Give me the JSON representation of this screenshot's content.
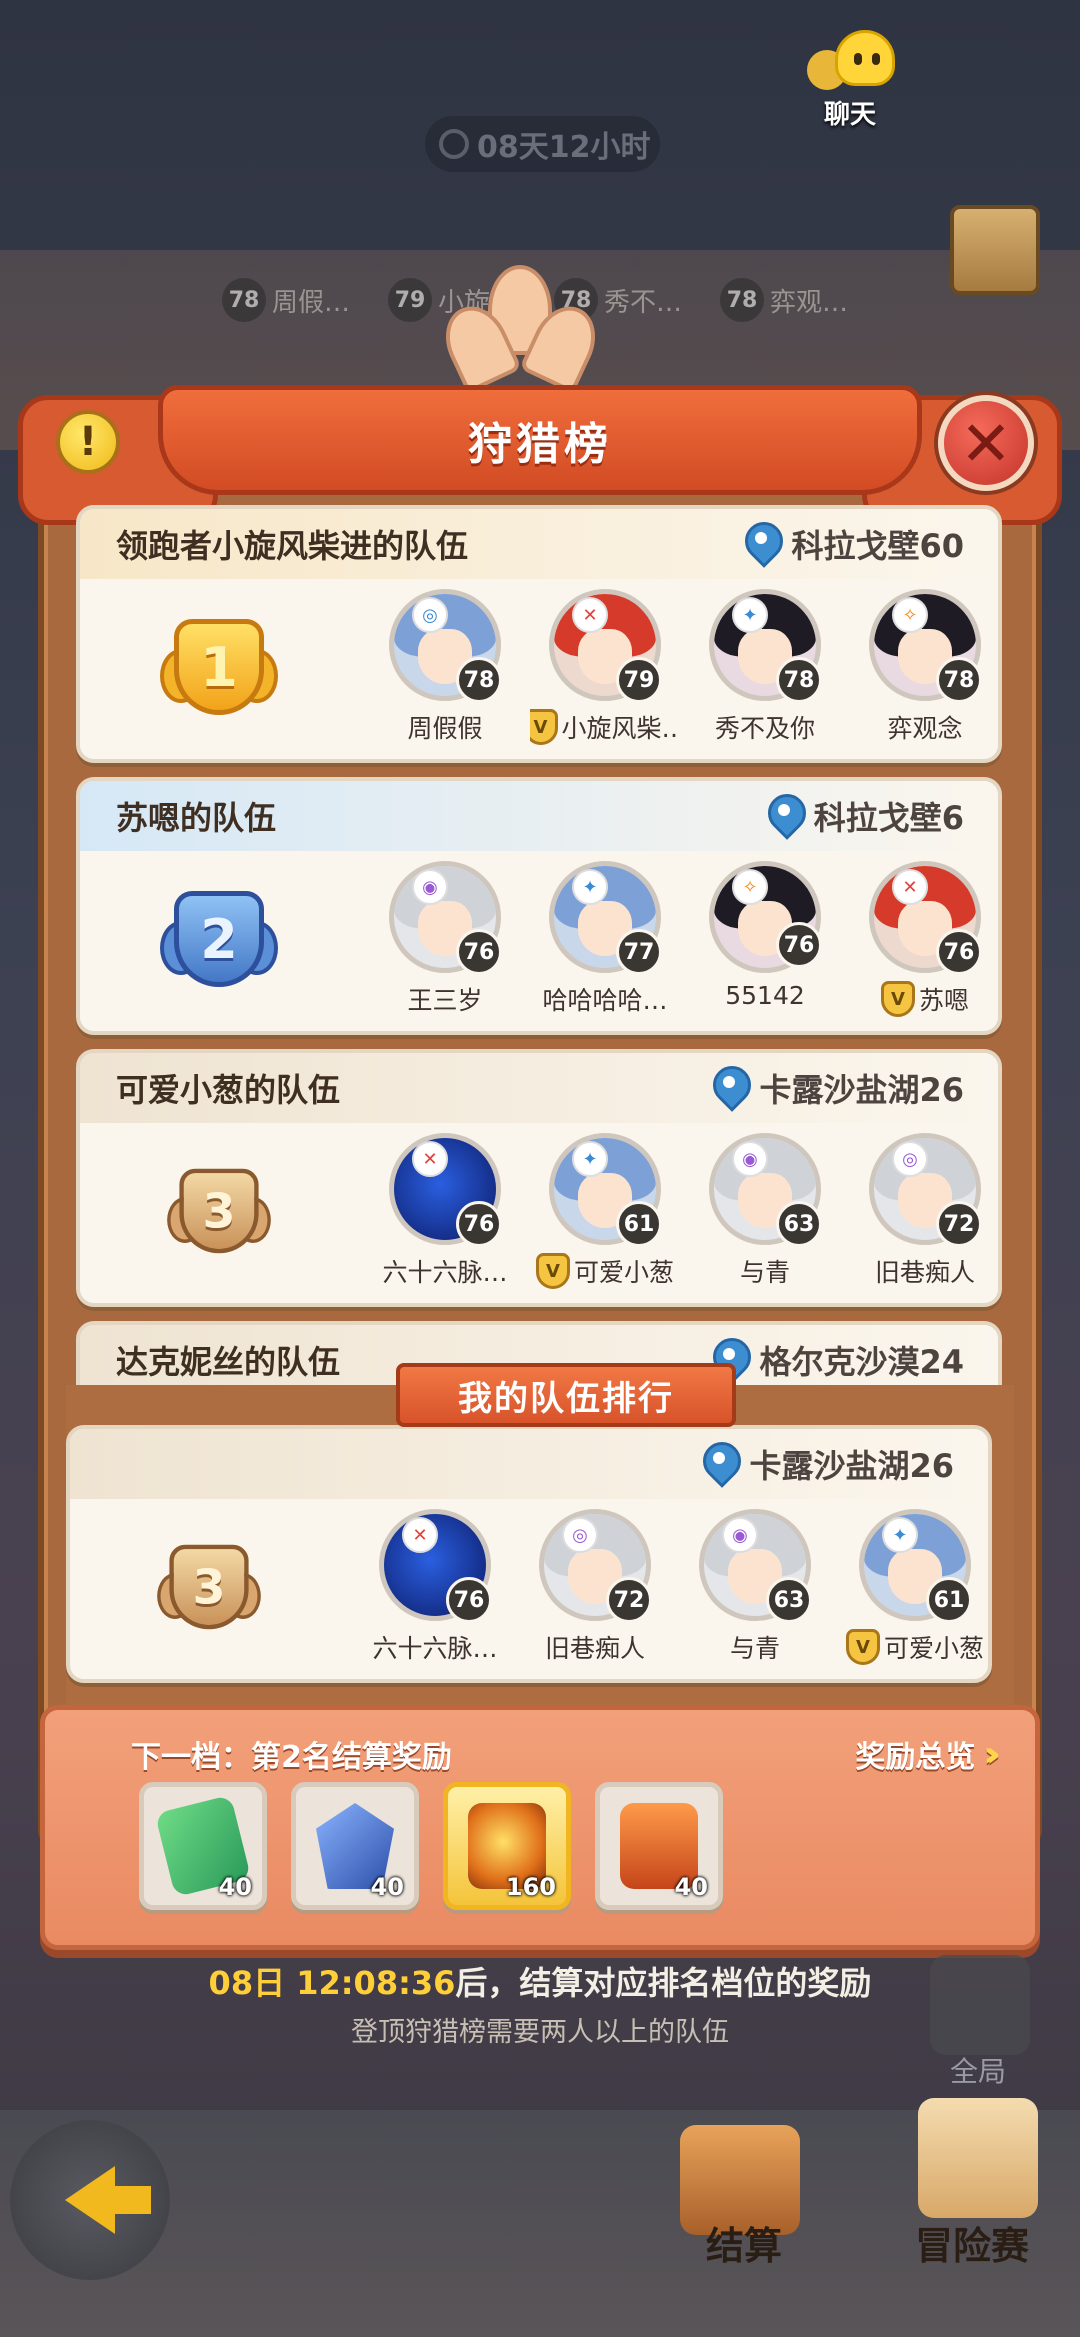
{
  "top": {
    "chat_label": "聊天",
    "timer": "08天12小时",
    "mini_teams": [
      {
        "level": "78",
        "name": "周假…"
      },
      {
        "level": "79",
        "name": "小旋…"
      },
      {
        "level": "78",
        "name": "秀不…"
      },
      {
        "level": "78",
        "name": "弈观…"
      }
    ]
  },
  "panel": {
    "title": "狩猎榜",
    "info_icon": "!",
    "close_icon": "✕"
  },
  "teams": [
    {
      "rank": "1",
      "name": "领跑者小旋风柴进的队伍",
      "location": "科拉戈壁60",
      "members": [
        {
          "name": "周假假",
          "level": "78",
          "elem": "◎"
        },
        {
          "name": "小旋风柴…",
          "level": "79",
          "elem": "✕",
          "leader": true
        },
        {
          "name": "秀不及你",
          "level": "78",
          "elem": "✦"
        },
        {
          "name": "弈观念",
          "level": "78",
          "elem": "✧"
        }
      ]
    },
    {
      "rank": "2",
      "name": "苏嗯的队伍",
      "location": "科拉戈壁6",
      "members": [
        {
          "name": "王三岁",
          "level": "76",
          "elem": "◉"
        },
        {
          "name": "哈哈哈哈…",
          "level": "77",
          "elem": "✦"
        },
        {
          "name": "55142",
          "level": "76",
          "elem": "✧"
        },
        {
          "name": "苏嗯",
          "level": "76",
          "elem": "✕",
          "leader": true
        }
      ]
    },
    {
      "rank": "3",
      "name": "可爱小葱的队伍",
      "location": "卡露沙盐湖26",
      "members": [
        {
          "name": "六十六脉…",
          "level": "76",
          "elem": "✕"
        },
        {
          "name": "可爱小葱",
          "level": "61",
          "elem": "✦",
          "leader": true
        },
        {
          "name": "与青",
          "level": "63",
          "elem": "◉"
        },
        {
          "name": "旧巷痴人",
          "level": "72",
          "elem": "◎"
        }
      ]
    },
    {
      "rank": "",
      "name": "达克妮丝的队伍",
      "location": "格尔克沙漠24",
      "members": []
    }
  ],
  "my_team": {
    "label": "我的队伍排行",
    "rank": "3",
    "location": "卡露沙盐湖26",
    "members": [
      {
        "name": "六十六脉…",
        "level": "76",
        "elem": "✕"
      },
      {
        "name": "旧巷痴人",
        "level": "72",
        "elem": "◎"
      },
      {
        "name": "与青",
        "level": "63",
        "elem": "◉"
      },
      {
        "name": "可爱小葱",
        "level": "61",
        "elem": "✦",
        "leader": true
      }
    ]
  },
  "reward": {
    "next_tier": "下一档：第2名结算奖励",
    "overview": "奖励总览",
    "items": [
      {
        "icon": "ticket-icon",
        "qty": "40"
      },
      {
        "icon": "crystal-icon",
        "qty": "40"
      },
      {
        "icon": "orb-icon",
        "qty": "160"
      },
      {
        "icon": "food-icon",
        "qty": "40"
      }
    ]
  },
  "notice": {
    "time": "08日 12:08:36",
    "suffix": "后，结算对应排名档位的奖励",
    "hint": "登顶狩猎榜需要两人以上的队伍"
  },
  "bottom": {
    "global_label": "全局",
    "tab_settle": "结算",
    "tab_adventure": "冒险赛"
  }
}
